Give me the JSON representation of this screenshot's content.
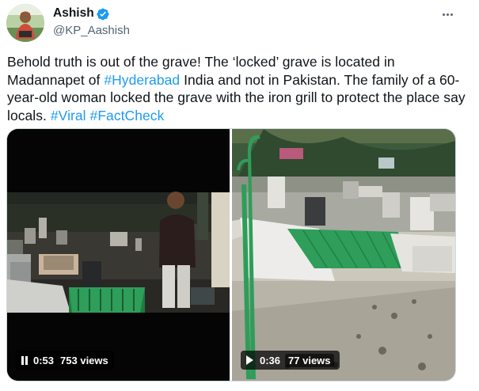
{
  "author": {
    "name": "Ashish",
    "handle": "@KP_Aashish",
    "verified": true
  },
  "tweet": {
    "segments": [
      {
        "text": "Behold truth is out of the grave! The ‘locked’ grave is located in Madannapet of ",
        "type": "text"
      },
      {
        "text": "#Hyderabad",
        "type": "hashtag"
      },
      {
        "text": " India and not in Pakistan. The family of a 60-year-old woman locked the grave with the iron grill to protect the place say locals. ",
        "type": "text"
      },
      {
        "text": "#Viral",
        "type": "hashtag"
      },
      {
        "text": " ",
        "type": "text"
      },
      {
        "text": "#FactCheck",
        "type": "hashtag"
      }
    ]
  },
  "media": {
    "videos": [
      {
        "time": "0:53",
        "views": "753 views",
        "state": "paused"
      },
      {
        "time": "0:36",
        "views": "77 views",
        "state": "play"
      }
    ]
  },
  "colors": {
    "link": "#1d9bf0",
    "verified": "#1d9bf0",
    "secondary_text": "#536471",
    "grave_grill": "#2e9e5a"
  },
  "icons": {
    "verified": "verified-badge-icon",
    "more": "more-options-icon",
    "pause": "pause-icon",
    "play": "play-icon"
  }
}
